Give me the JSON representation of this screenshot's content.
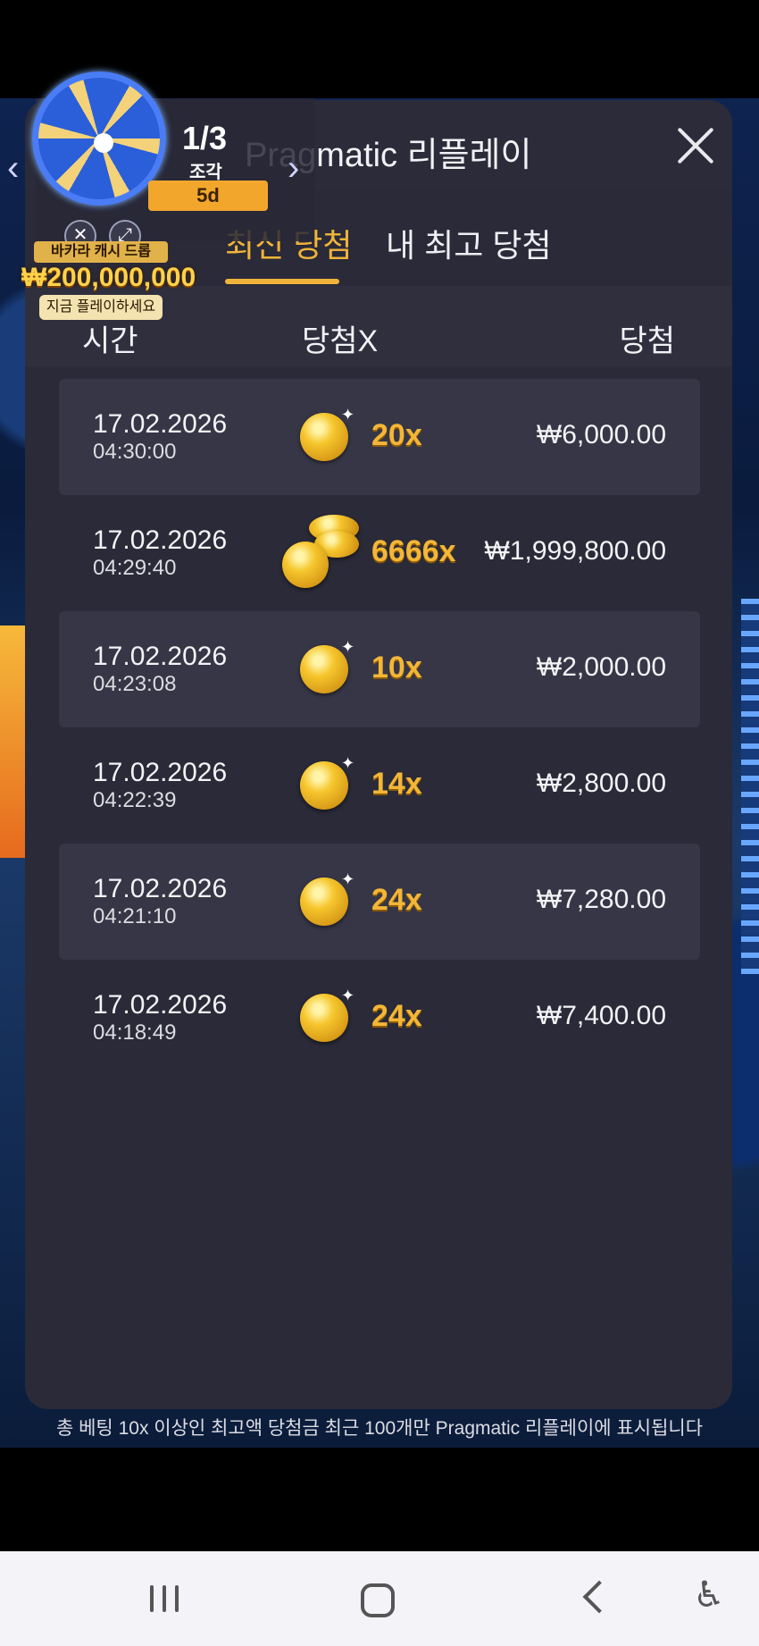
{
  "modal": {
    "title": "Pragmatic 리플레이",
    "tabs": [
      {
        "label": "최신 당첨",
        "active": true
      },
      {
        "label": "내 최고 당첨",
        "active": false
      }
    ],
    "columns": {
      "time": "시간",
      "multiplier": "당첨X",
      "win": "당첨"
    },
    "rows": [
      {
        "date": "17.02.2026",
        "time": "04:30:00",
        "multiplier": "20x",
        "amount": "₩6,000.00",
        "icon": "gold-coin-icon"
      },
      {
        "date": "17.02.2026",
        "time": "04:29:40",
        "multiplier": "6666x",
        "amount": "₩1,999,800.00",
        "icon": "gold-coin-pile-icon"
      },
      {
        "date": "17.02.2026",
        "time": "04:23:08",
        "multiplier": "10x",
        "amount": "₩2,000.00",
        "icon": "gold-coin-icon"
      },
      {
        "date": "17.02.2026",
        "time": "04:22:39",
        "multiplier": "14x",
        "amount": "₩2,800.00",
        "icon": "gold-coin-icon"
      },
      {
        "date": "17.02.2026",
        "time": "04:21:10",
        "multiplier": "24x",
        "amount": "₩7,280.00",
        "icon": "gold-coin-icon"
      },
      {
        "date": "17.02.2026",
        "time": "04:18:49",
        "multiplier": "24x",
        "amount": "₩7,400.00",
        "icon": "gold-coin-icon"
      }
    ],
    "footer_note": "총 베팅 10x 이상인 최고액 당첨금 최근 100개만 Pragmatic 리플레이에 표시됩니다"
  },
  "widget": {
    "progress": "1/3",
    "pieces_label": "조각",
    "days_left": "5d",
    "promo_title": "바카라 캐시 드롭",
    "promo_amount": "₩200,000,000",
    "promo_cta": "지금 플레이하세요"
  },
  "colors": {
    "accent": "#f0b43a",
    "panel": "#2a2a38",
    "row_shade": "#363646"
  }
}
